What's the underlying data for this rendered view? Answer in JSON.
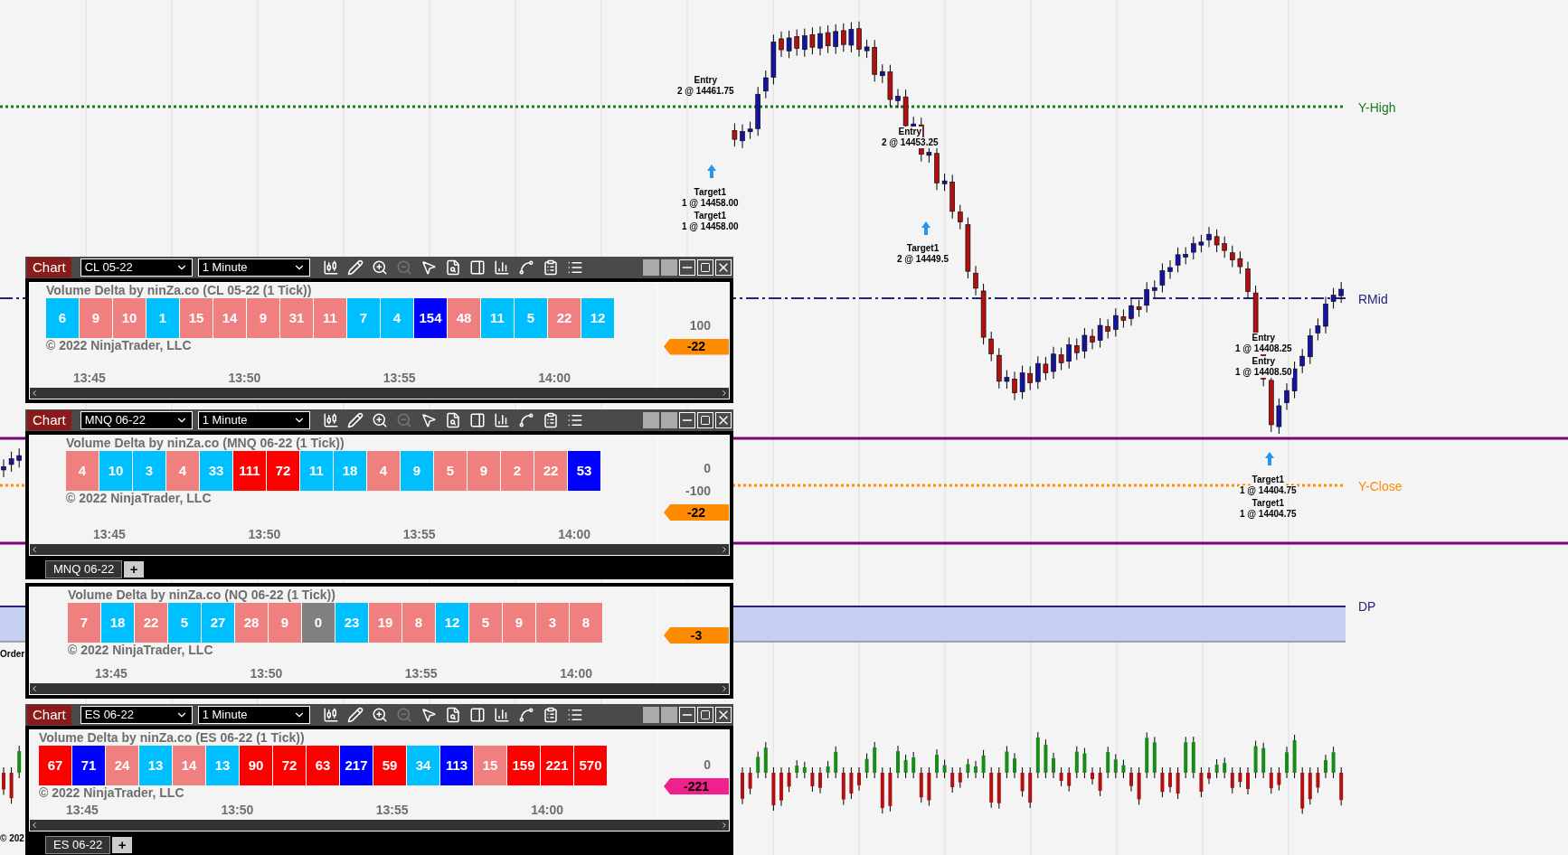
{
  "chart": {
    "levels": [
      {
        "label": "Y-High",
        "kind": "dotted",
        "color": "#1a7a1a"
      },
      {
        "label": "RMid",
        "kind": "dashed",
        "color": "#23237a"
      },
      {
        "label": "Y-Close",
        "kind": "dotted",
        "color": "#ff8c00"
      },
      {
        "label": "DP",
        "kind": "band",
        "color": "#23237a"
      }
    ],
    "trades": [
      {
        "title": "Entry",
        "detail": "2 @ 14461.75"
      },
      {
        "title": "Target1",
        "detail": "1 @ 14458.00"
      },
      {
        "title": "Target1",
        "detail": "1 @ 14458.00"
      },
      {
        "title": "Entry",
        "detail": "2 @ 14453.25"
      },
      {
        "title": "Target1",
        "detail": "2 @ 14449.5"
      },
      {
        "title": "Entry",
        "detail": "1 @ 14408.25"
      },
      {
        "title": "Entry",
        "detail": "1 @ 14408.50"
      },
      {
        "title": "Target1",
        "detail": "1 @ 14404.75"
      },
      {
        "title": "Target1",
        "detail": "1 @ 14404.75"
      }
    ],
    "edge_texts": [
      "Order",
      "© 202"
    ]
  },
  "windows": [
    {
      "toolbar": {
        "title": "Chart",
        "instrument": "CL 05-22",
        "interval": "1 Minute"
      },
      "indicator": "Volume Delta by ninZa.co (CL 05-22 (1 Tick))",
      "copyright": "© 2022 NinjaTrader, LLC",
      "axis": [
        "100"
      ],
      "badge": {
        "text": "-22",
        "color": "#ff8c00"
      },
      "cells": [
        {
          "value": "6",
          "color": "#00bfff"
        },
        {
          "value": "9",
          "color": "#f08080"
        },
        {
          "value": "10",
          "color": "#f08080"
        },
        {
          "value": "1",
          "color": "#00bfff"
        },
        {
          "value": "15",
          "color": "#f08080"
        },
        {
          "value": "14",
          "color": "#f08080"
        },
        {
          "value": "9",
          "color": "#f08080"
        },
        {
          "value": "31",
          "color": "#f08080"
        },
        {
          "value": "11",
          "color": "#f08080"
        },
        {
          "value": "7",
          "color": "#00bfff"
        },
        {
          "value": "4",
          "color": "#00bfff"
        },
        {
          "value": "154",
          "color": "#0000ff"
        },
        {
          "value": "48",
          "color": "#f08080"
        },
        {
          "value": "11",
          "color": "#00bfff"
        },
        {
          "value": "5",
          "color": "#00bfff"
        },
        {
          "value": "22",
          "color": "#f08080"
        },
        {
          "value": "12",
          "color": "#00bfff"
        }
      ],
      "times": [
        "13:45",
        "13:50",
        "13:55",
        "14:00"
      ]
    },
    {
      "toolbar": {
        "title": "Chart",
        "instrument": "MNQ 06-22",
        "interval": "1 Minute"
      },
      "indicator": "Volume Delta by ninZa.co (MNQ 06-22 (1 Tick))",
      "copyright": "© 2022 NinjaTrader, LLC",
      "axis": [
        "0",
        "-100"
      ],
      "badge": {
        "text": "-22",
        "color": "#ff8c00"
      },
      "cells": [
        {
          "value": "4",
          "color": "#f08080"
        },
        {
          "value": "10",
          "color": "#00bfff"
        },
        {
          "value": "3",
          "color": "#00bfff"
        },
        {
          "value": "4",
          "color": "#f08080"
        },
        {
          "value": "33",
          "color": "#00bfff"
        },
        {
          "value": "111",
          "color": "#ff0000"
        },
        {
          "value": "72",
          "color": "#ff0000"
        },
        {
          "value": "11",
          "color": "#00bfff"
        },
        {
          "value": "18",
          "color": "#00bfff"
        },
        {
          "value": "4",
          "color": "#f08080"
        },
        {
          "value": "9",
          "color": "#00bfff"
        },
        {
          "value": "5",
          "color": "#f08080"
        },
        {
          "value": "9",
          "color": "#f08080"
        },
        {
          "value": "2",
          "color": "#f08080"
        },
        {
          "value": "22",
          "color": "#f08080"
        },
        {
          "value": "53",
          "color": "#0000ff"
        }
      ],
      "times": [
        "13:45",
        "13:50",
        "13:55",
        "14:00"
      ],
      "tab": {
        "label": "MNQ 06-22",
        "add": "+"
      }
    },
    {
      "indicator": "Volume Delta by ninZa.co (NQ 06-22 (1 Tick))",
      "copyright": "© 2022 NinjaTrader, LLC",
      "badge": {
        "text": "-3",
        "color": "#ff8c00"
      },
      "cells": [
        {
          "value": "7",
          "color": "#f08080"
        },
        {
          "value": "18",
          "color": "#00bfff"
        },
        {
          "value": "22",
          "color": "#f08080"
        },
        {
          "value": "5",
          "color": "#00bfff"
        },
        {
          "value": "27",
          "color": "#00bfff"
        },
        {
          "value": "28",
          "color": "#f08080"
        },
        {
          "value": "9",
          "color": "#f08080"
        },
        {
          "value": "0",
          "color": "#808080"
        },
        {
          "value": "23",
          "color": "#00bfff"
        },
        {
          "value": "19",
          "color": "#f08080"
        },
        {
          "value": "8",
          "color": "#f08080"
        },
        {
          "value": "12",
          "color": "#00bfff"
        },
        {
          "value": "5",
          "color": "#f08080"
        },
        {
          "value": "9",
          "color": "#f08080"
        },
        {
          "value": "3",
          "color": "#f08080"
        },
        {
          "value": "8",
          "color": "#f08080"
        }
      ],
      "times": [
        "13:45",
        "13:50",
        "13:55",
        "14:00"
      ]
    },
    {
      "toolbar": {
        "title": "Chart",
        "instrument": "ES 06-22",
        "interval": "1 Minute"
      },
      "indicator": "Volume Delta by ninZa.co (ES 06-22 (1 Tick))",
      "copyright": "© 2022 NinjaTrader, LLC",
      "axis": [
        "0"
      ],
      "badge": {
        "text": "-221",
        "color": "#f0208c"
      },
      "cells": [
        {
          "value": "67",
          "color": "#ff0000"
        },
        {
          "value": "71",
          "color": "#0000ff"
        },
        {
          "value": "24",
          "color": "#f08080"
        },
        {
          "value": "13",
          "color": "#00bfff"
        },
        {
          "value": "14",
          "color": "#f08080"
        },
        {
          "value": "13",
          "color": "#00bfff"
        },
        {
          "value": "90",
          "color": "#ff0000"
        },
        {
          "value": "72",
          "color": "#ff0000"
        },
        {
          "value": "63",
          "color": "#ff0000"
        },
        {
          "value": "217",
          "color": "#0000ff"
        },
        {
          "value": "59",
          "color": "#ff0000"
        },
        {
          "value": "34",
          "color": "#00bfff"
        },
        {
          "value": "113",
          "color": "#0000ff"
        },
        {
          "value": "15",
          "color": "#f08080"
        },
        {
          "value": "159",
          "color": "#ff0000"
        },
        {
          "value": "221",
          "color": "#ff0000"
        },
        {
          "value": "570",
          "color": "#ff0000"
        }
      ],
      "times": [
        "13:45",
        "13:50",
        "13:55",
        "14:00"
      ],
      "tab": {
        "label": "ES 06-22",
        "add": "+"
      }
    }
  ]
}
